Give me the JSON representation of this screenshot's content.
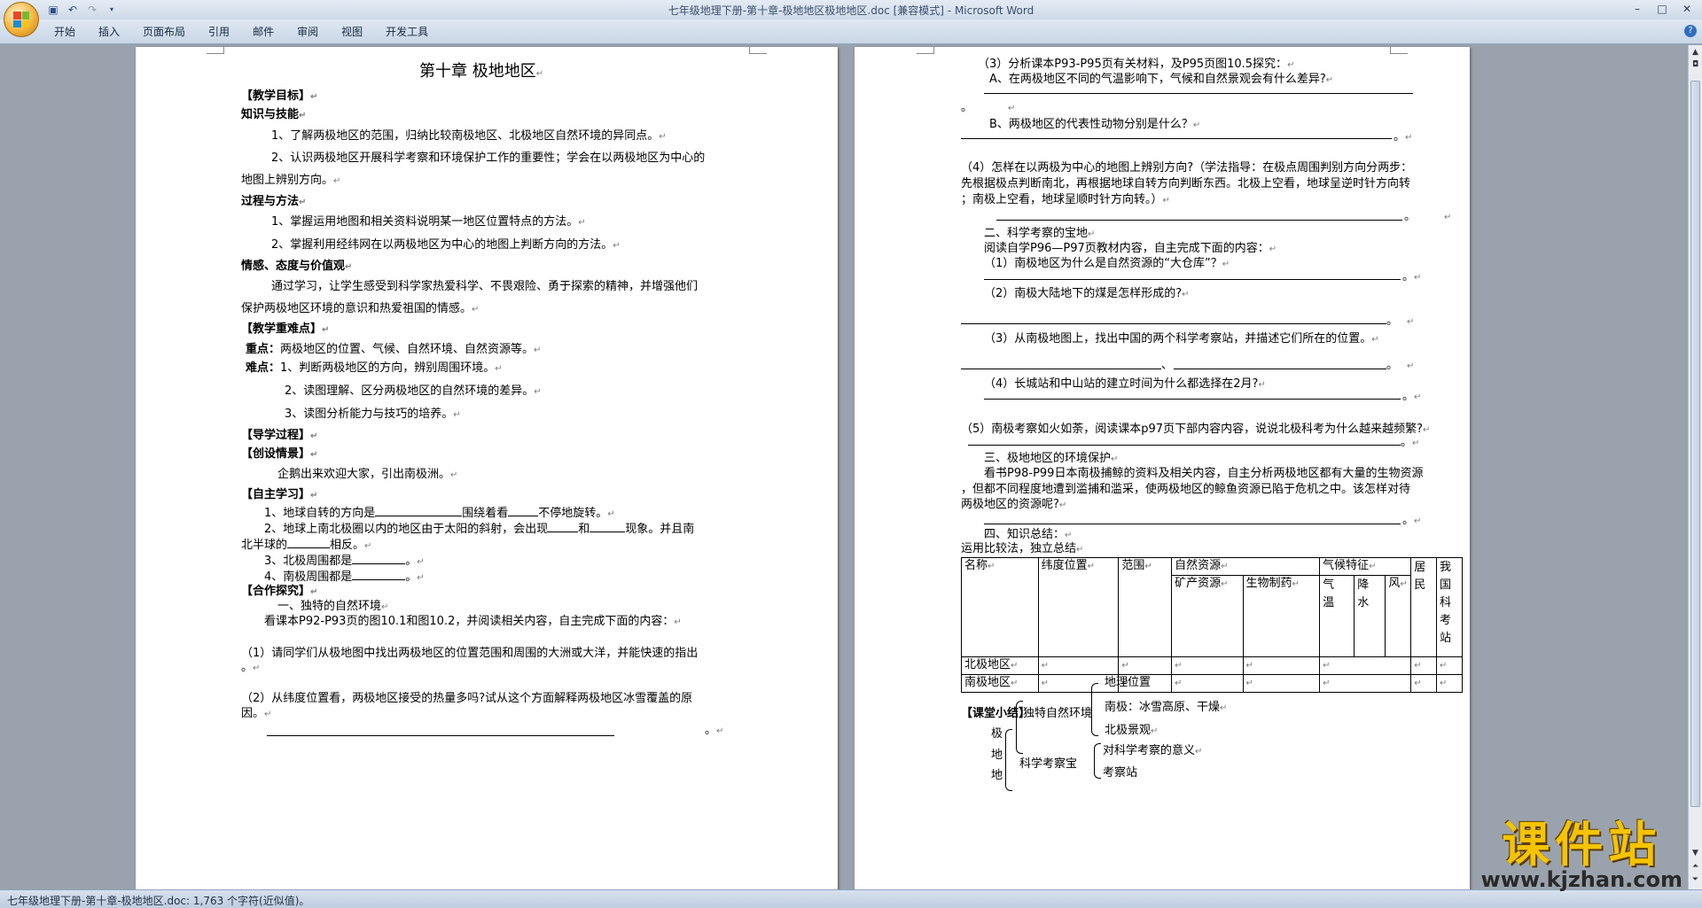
{
  "window": {
    "title": "七年级地理下册-第十章-极地地区极地地区.doc [兼容模式]",
    "brand": " - Microsoft Word"
  },
  "ribbon": {
    "tabs": [
      "开始",
      "插入",
      "页面布局",
      "引用",
      "邮件",
      "审阅",
      "视图",
      "开发工具"
    ]
  },
  "status": "七年级地理下册-第十章-极地地区.doc: 1,763 个字符(近似值)。",
  "mark": "↵",
  "watermark": {
    "cn": "课件站",
    "url": "www.kjzhan.com"
  },
  "page1": {
    "title": "第十章 极地地区",
    "lines": [
      "【教学目标】",
      "知识与技能",
      "1、了解两极地区的范围，归纳比较南极地区、北极地区自然环境的异同点。",
      "2、认识两极地区开展科学考察和环境保护工作的重要性；学会在以两极地区为中心的",
      "地图上辨别方向。",
      "过程与方法",
      "1、掌握运用地图和相关资料说明某一地区位置特点的方法。",
      "2、掌握利用经纬网在以两极地区为中心的地图上判断方向的方法。",
      "情感、态度与价值观",
      "通过学习，让学生感受到科学家热爱科学、不畏艰险、勇于探索的精神，并增强他们",
      "保护两极地区环境的意识和热爱祖国的情感。",
      "【教学重难点】",
      "重点：",
      "两极地区的位置、气候、自然环境、自然资源等。",
      "难点：",
      "1、判断两极地区的方向，辨别周围环境。",
      "2、读图理解、区分两极地区的自然环境的差异。",
      "3、读图分析能力与技巧的培养。",
      "【导学过程】",
      "【创设情景】",
      "企鹅出来欢迎大家，引出南极洲。",
      "【自主学习】",
      "1、地球自转的方向是",
      "围绕着看",
      "不停地旋转。",
      "2、地球上南北极圈以内的地区由于太阳的斜射，会出现",
      "和",
      "现象。并且南",
      "北半球的",
      "相反。",
      "3、北极周围都是",
      "4、南极周围都是",
      "【合作探究】",
      "一、独特的自然环境",
      "看课本P92-P93页的图10.1和图10.2，并阅读相关内容，自主完成下面的内容：",
      "（1）请同学们从极地图中找出两极地区的位置范围和周围的大洲或大洋，并能快速的指出",
      "。",
      "（2）从纬度位置看，两极地区接受的热量多吗?试从这个方面解释两极地区冰雪覆盖的原",
      "因。",
      "。"
    ]
  },
  "page2": {
    "lines": [
      "（3）分析课本P93-P95页有关材料，及P95页图10.5探究：",
      "A、在两极地区不同的气温影响下，气候和自然景观会有什么差异?",
      "。",
      "B、两极地区的代表性动物分别是什么？",
      "。",
      "（4）怎样在以两极为中心的地图上辨别方向?（学法指导：在极点周围判别方向分两步：",
      "先根据极点判断南北，再根据地球自转方向判断东西。北极上空看，地球呈逆时针方向转",
      "；南极上空看，地球呈顺时针方向转。）",
      "。",
      "二、科学考察的宝地",
      "阅读自学P96—P97页教材内容，自主完成下面的内容：",
      "（1）南极地区为什么是自然资源的“大仓库”？",
      "。",
      "（2）南极大陆地下的煤是怎样形成的?",
      "。",
      "（3）从南极地图上，找出中国的两个科学考察站，并描述它们所在的位置。",
      "、",
      "。",
      "（4）长城站和中山站的建立时间为什么都选择在2月?",
      "。",
      "（5）南极考察如火如荼，阅读课本p97页下部内容内容，说说北极科考为什么越来越频繁?",
      "。",
      "三、极地地区的环境保护",
      "看书P98-P99日本南极捕鲸的资料及相关内容，自主分析两极地区都有大量的生物资源",
      "，但都不同程度地遭到滥捕和滥采，使两极地区的鲸鱼资源已陷于危机之中。该怎样对待",
      "两极地区的资源呢?",
      "。",
      "四、知识总结：",
      "运用比较法，独立总结",
      "【课堂小结】",
      "极",
      "地",
      "地",
      "独特自然环境",
      "地理位置",
      "南极：冰雪高原、干燥",
      "北极景观",
      "科学考察宝",
      "对科学考察的意义",
      "考察站"
    ],
    "table": {
      "h": [
        "名称",
        "纬度位置",
        "范围",
        "自然资源",
        "气候特征",
        "居民",
        "我国科考站"
      ],
      "res": [
        "矿产资源",
        "生物制药"
      ],
      "clim": [
        "气温",
        "降水",
        "风"
      ],
      "rows": [
        "北极地区",
        "南极地区"
      ]
    }
  }
}
